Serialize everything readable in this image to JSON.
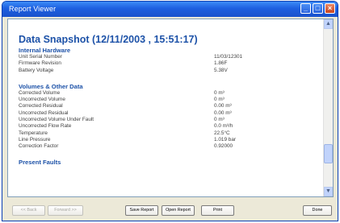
{
  "window": {
    "title": "Report Viewer"
  },
  "report": {
    "heading": "Data Snapshot (12/11/2003 , 15:51:17)",
    "sections": [
      {
        "title": "Internal Hardware",
        "rows": [
          {
            "label": "Unit Serial Number",
            "value": "11/03/12301"
          },
          {
            "label": "Firmware Revision",
            "value": "1.86F"
          },
          {
            "label": "Battery Voltage",
            "value": "5.38V"
          }
        ]
      },
      {
        "title": "Volumes & Other Data",
        "rows": [
          {
            "label": "Corrected Volume",
            "value": "0 m³"
          },
          {
            "label": "Uncorrected Volume",
            "value": "0 m³"
          },
          {
            "label": "Corrected Residual",
            "value": "0.00 m³"
          },
          {
            "label": "Uncorrected Residual",
            "value": "0.00 m³"
          },
          {
            "label": "Uncorrected Volume Under Fault",
            "value": "0 m³"
          },
          {
            "label": "Uncorrected Flow Rate",
            "value": "0.0 m³/h"
          },
          {
            "label": "Temperature",
            "value": "22.5°C"
          },
          {
            "label": "Line Pressure",
            "value": "1.019 bar"
          },
          {
            "label": "Correction Factor",
            "value": "0.92000"
          }
        ]
      },
      {
        "title": "Present Faults",
        "rows": []
      }
    ]
  },
  "buttons": {
    "back": "<< Back",
    "forward": "Forward >>",
    "save": "Save Report",
    "open": "Open Report",
    "print": "Print",
    "done": "Done"
  }
}
